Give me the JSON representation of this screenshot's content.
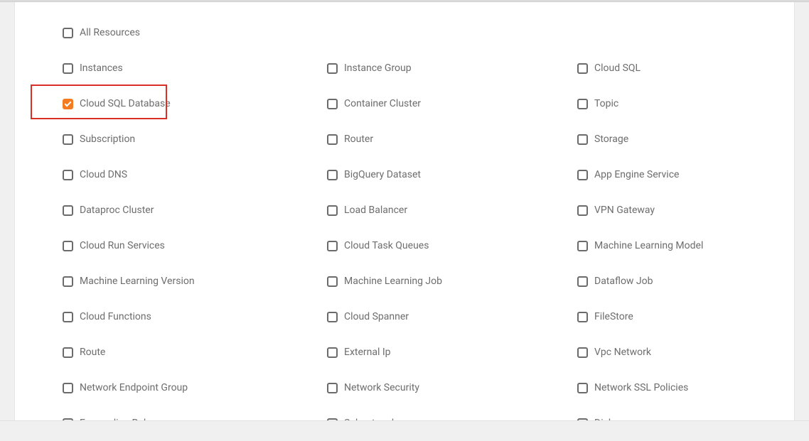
{
  "allResources": {
    "label": "All Resources",
    "checked": false
  },
  "rows": [
    [
      {
        "label": "Instances",
        "checked": false
      },
      {
        "label": "Instance Group",
        "checked": false
      },
      {
        "label": "Cloud SQL",
        "checked": false
      }
    ],
    [
      {
        "label": "Cloud SQL Database",
        "checked": true
      },
      {
        "label": "Container Cluster",
        "checked": false
      },
      {
        "label": "Topic",
        "checked": false
      }
    ],
    [
      {
        "label": "Subscription",
        "checked": false
      },
      {
        "label": "Router",
        "checked": false
      },
      {
        "label": "Storage",
        "checked": false
      }
    ],
    [
      {
        "label": "Cloud DNS",
        "checked": false
      },
      {
        "label": "BigQuery Dataset",
        "checked": false
      },
      {
        "label": "App Engine Service",
        "checked": false
      }
    ],
    [
      {
        "label": "Dataproc Cluster",
        "checked": false
      },
      {
        "label": "Load Balancer",
        "checked": false
      },
      {
        "label": "VPN Gateway",
        "checked": false
      }
    ],
    [
      {
        "label": "Cloud Run Services",
        "checked": false
      },
      {
        "label": "Cloud Task Queues",
        "checked": false
      },
      {
        "label": "Machine Learning Model",
        "checked": false
      }
    ],
    [
      {
        "label": "Machine Learning Version",
        "checked": false
      },
      {
        "label": "Machine Learning Job",
        "checked": false
      },
      {
        "label": "Dataflow Job",
        "checked": false
      }
    ],
    [
      {
        "label": "Cloud Functions",
        "checked": false
      },
      {
        "label": "Cloud Spanner",
        "checked": false
      },
      {
        "label": "FileStore",
        "checked": false
      }
    ],
    [
      {
        "label": "Route",
        "checked": false
      },
      {
        "label": "External Ip",
        "checked": false
      },
      {
        "label": "Vpc Network",
        "checked": false
      }
    ],
    [
      {
        "label": "Network Endpoint Group",
        "checked": false
      },
      {
        "label": "Network Security",
        "checked": false
      },
      {
        "label": "Network SSL Policies",
        "checked": false
      }
    ],
    [
      {
        "label": "Forwarding Rule",
        "checked": false
      },
      {
        "label": "Subnetwork",
        "checked": false
      },
      {
        "label": "Disks",
        "checked": false
      }
    ]
  ],
  "colors": {
    "accent": "#f47b20",
    "highlight": "#d93025"
  }
}
